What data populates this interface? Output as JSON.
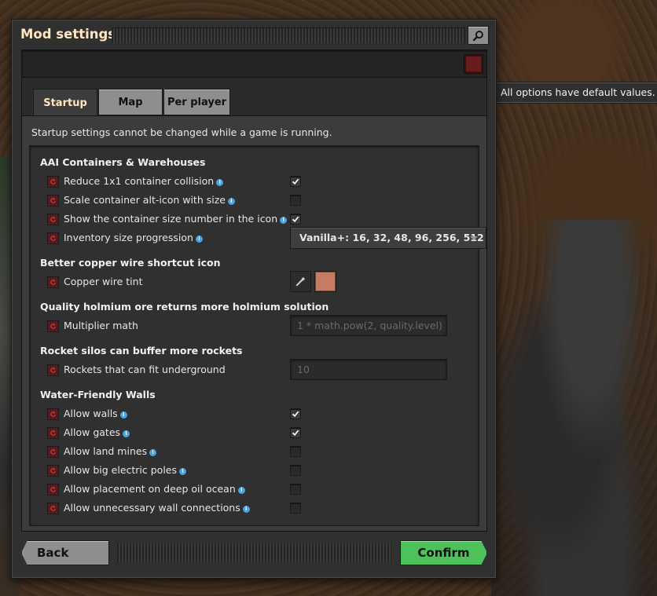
{
  "window": {
    "title": "Mod settings",
    "tooltip": "All options have default values."
  },
  "tabs": [
    {
      "label": "Startup",
      "active": true
    },
    {
      "label": "Map",
      "active": false
    },
    {
      "label": "Per player",
      "active": false
    }
  ],
  "notice": "Startup settings cannot be changed while a game is running.",
  "groups": [
    {
      "title": "AAI Containers & Warehouses",
      "settings": [
        {
          "label": "Reduce 1x1 container collision",
          "type": "checkbox",
          "checked": true,
          "info": true
        },
        {
          "label": "Scale container alt-icon with size",
          "type": "checkbox",
          "checked": false,
          "info": true
        },
        {
          "label": "Show the container size number in the icon",
          "type": "checkbox",
          "checked": true,
          "info": true
        },
        {
          "label": "Inventory size progression",
          "type": "dropdown",
          "value": "Vanilla+: 16, 32, 48, 96, 256, 512",
          "info": true
        }
      ]
    },
    {
      "title": "Better copper wire shortcut icon",
      "settings": [
        {
          "label": "Copper wire tint",
          "type": "color",
          "color": "#c77b62",
          "info": false
        }
      ]
    },
    {
      "title": "Quality holmium ore returns more holmium solution",
      "settings": [
        {
          "label": "Multiplier math",
          "type": "text",
          "placeholder": "1 * math.pow(2, quality.level)",
          "info": false
        }
      ]
    },
    {
      "title": "Rocket silos can buffer more rockets",
      "settings": [
        {
          "label": "Rockets that can fit underground",
          "type": "text",
          "placeholder": "10",
          "info": false
        }
      ]
    },
    {
      "title": "Water-Friendly Walls",
      "settings": [
        {
          "label": "Allow walls",
          "type": "checkbox",
          "checked": true,
          "info": true
        },
        {
          "label": "Allow gates",
          "type": "checkbox",
          "checked": true,
          "info": true
        },
        {
          "label": "Allow land mines",
          "type": "checkbox",
          "checked": false,
          "info": true
        },
        {
          "label": "Allow big electric poles",
          "type": "checkbox",
          "checked": false,
          "info": true
        },
        {
          "label": "Allow placement on deep oil ocean",
          "type": "checkbox",
          "checked": false,
          "info": true
        },
        {
          "label": "Allow unnecessary wall connections",
          "type": "checkbox",
          "checked": false,
          "info": true
        }
      ]
    }
  ],
  "buttons": {
    "back": "Back",
    "confirm": "Confirm"
  },
  "icons": {
    "search": "search-icon",
    "reset": "reset-icon",
    "info": "info-icon",
    "checkmark": "checkmark-icon",
    "eyedropper": "eyedropper-icon",
    "dropdown": "chevron-down-icon"
  },
  "colors": {
    "title": "#ffe6c0",
    "confirm": "#4dc25a",
    "reset": "#5c1818",
    "info": "#4aa3df"
  }
}
